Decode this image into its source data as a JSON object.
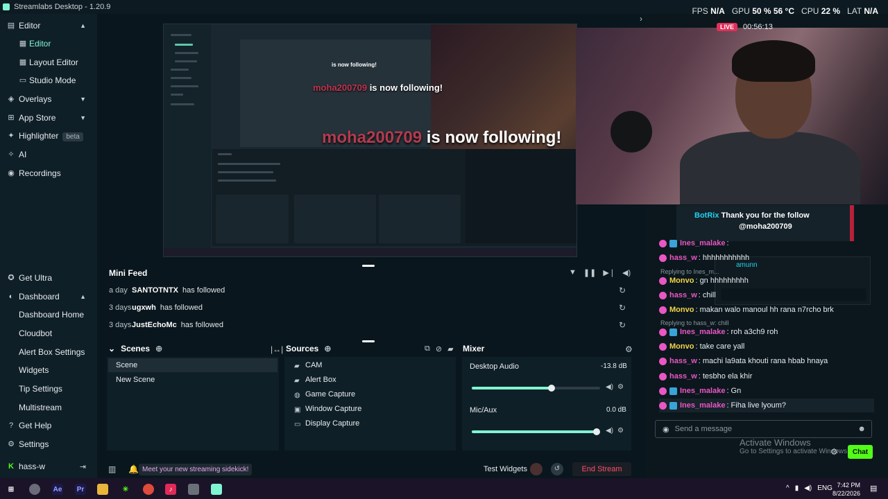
{
  "window": {
    "title": "Streamlabs Desktop - 1.20.9"
  },
  "perf": {
    "fps_label": "FPS",
    "fps": "N/A",
    "gpu_label": "GPU",
    "gpu": "50 % 56 °C",
    "cpu_label": "CPU",
    "cpu": "22 %",
    "lat_label": "LAT",
    "lat": "N/A"
  },
  "sidebar": {
    "editor": "Editor",
    "editor_sub": "Editor",
    "layout_editor": "Layout Editor",
    "studio_mode": "Studio Mode",
    "overlays": "Overlays",
    "app_store": "App Store",
    "highlighter": "Highlighter",
    "highlighter_badge": "beta",
    "ai": "AI",
    "recordings": "Recordings",
    "get_ultra": "Get Ultra",
    "dashboard": "Dashboard",
    "dashboard_home": "Dashboard Home",
    "cloudbot": "Cloudbot",
    "alert_box_settings": "Alert Box Settings",
    "widgets": "Widgets",
    "tip_settings": "Tip Settings",
    "multistream": "Multistream",
    "get_help": "Get Help",
    "settings": "Settings",
    "user": "hass-w"
  },
  "preview": {
    "follow_big_name": "moha200709",
    "follow_big_text": "is now following!",
    "follow_mid_name": "moha200709",
    "follow_mid_text": "is now following!",
    "follow_sm_text": "is now following!"
  },
  "minifeed": {
    "title": "Mini Feed",
    "rows": [
      {
        "time": "a day",
        "name": "SANTOTNTX",
        "action": "has followed"
      },
      {
        "time": "3 days",
        "name": "ugxwh",
        "action": "has followed"
      },
      {
        "time": "3 days",
        "name": "JustEchoMc",
        "action": "has followed"
      }
    ]
  },
  "scenes": {
    "title": "Scenes",
    "items": [
      "Scene",
      "New Scene"
    ]
  },
  "sources": {
    "title": "Sources",
    "items": [
      "CAM",
      "Alert Box",
      "Game Capture",
      "Window Capture",
      "Display Capture"
    ]
  },
  "mixer": {
    "title": "Mixer",
    "channels": [
      {
        "name": "Desktop Audio",
        "db": "-13.8 dB",
        "level": 0.62
      },
      {
        "name": "Mic/Aux",
        "db": "0.0 dB",
        "level": 1.0
      }
    ]
  },
  "statusbar": {
    "promo": "Meet your new streaming sidekick!",
    "test_widgets": "Test Widgets",
    "end_stream": "End Stream"
  },
  "live": {
    "badge": "LIVE",
    "timer": "00:56:13"
  },
  "chat": {
    "bot": {
      "name": "BotRix",
      "text": "Thank you for the follow",
      "mention": "@moha200709"
    },
    "popup_user": "amunn",
    "reply1": "Replying to Ines_m...",
    "reply2": "Replying to hass_w: chill",
    "messages": [
      {
        "user": "Ines_malake",
        "text": ":",
        "cls": "pink"
      },
      {
        "user": "hass_w",
        "text": ": hhhhhhhhhhh",
        "cls": "pink"
      },
      {
        "user": "Monvo",
        "text": ": gn hhhhhhhhh",
        "cls": "yellow"
      },
      {
        "user": "hass_w",
        "text": ": chill",
        "cls": "pink"
      },
      {
        "user": "Monvo",
        "text": ": makan walo manoul hh rana n7rcho brk",
        "cls": "yellow"
      },
      {
        "user": "Ines_malake",
        "text": ": roh a3ch9 roh",
        "cls": "pink"
      },
      {
        "user": "Monvo",
        "text": ": take care yall",
        "cls": "yellow"
      },
      {
        "user": "hass_w",
        "text": ": machi la9ata khouti rana hbab hnaya",
        "cls": "pink"
      },
      {
        "user": "hass_w",
        "text": ": tesbho ela khir",
        "cls": "pink"
      },
      {
        "user": "Ines_malake",
        "text": ": Gn",
        "cls": "pink"
      },
      {
        "user": "Ines_malake",
        "text": ": Fiha live lyoum?",
        "cls": "pink"
      }
    ],
    "placeholder": "Send a message",
    "send_label": "Chat"
  },
  "activate": {
    "title": "Activate Windows",
    "sub": "Go to Settings to activate Windows."
  },
  "clock": {
    "time": "7:42 PM",
    "date": "8/22/2026",
    "lang": "ENG"
  },
  "colors": {
    "accent": "#80f5d2",
    "live": "#e0305a",
    "kick": "#53fc18",
    "end_stream": "#ff4d6a"
  }
}
